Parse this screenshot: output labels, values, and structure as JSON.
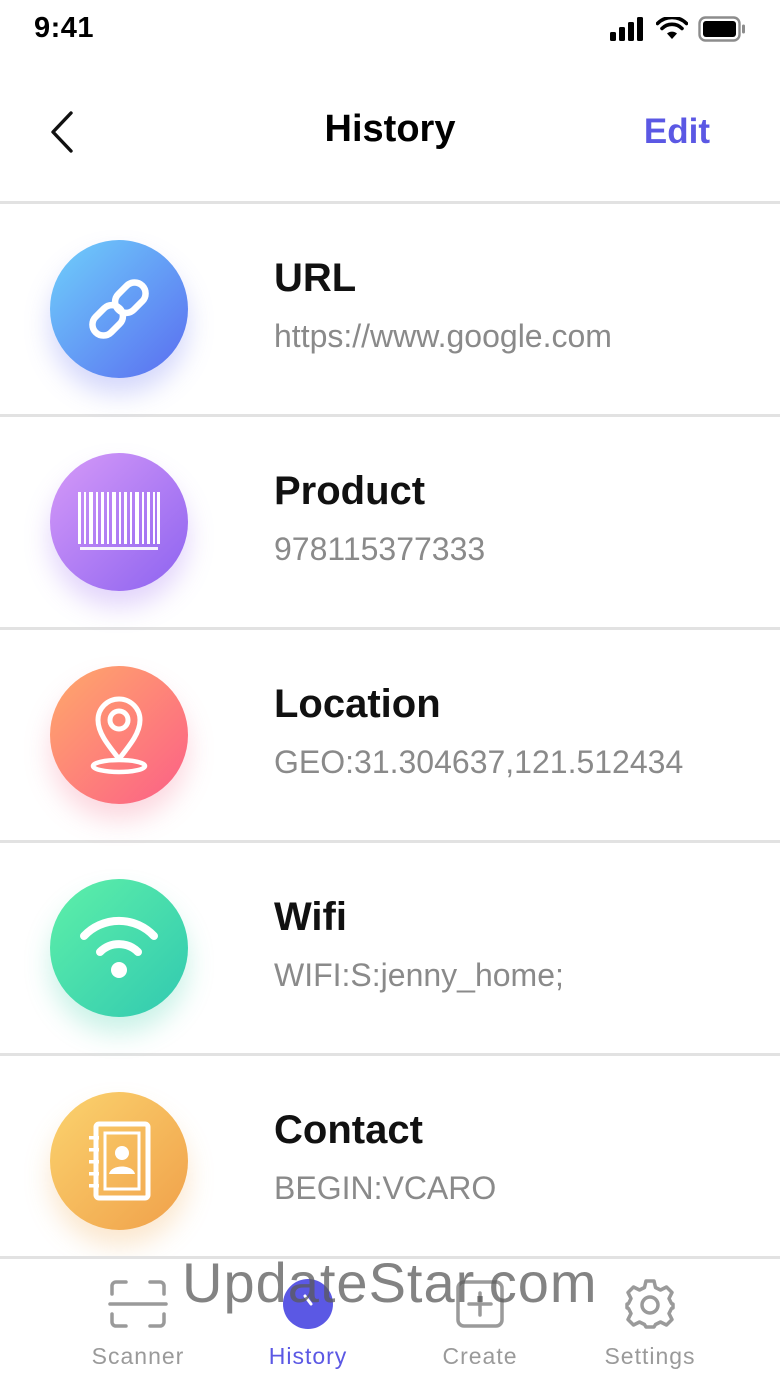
{
  "status_bar": {
    "time": "9:41",
    "icons": [
      "signal-icon",
      "wifi-icon",
      "battery-icon"
    ]
  },
  "nav": {
    "back_icon": "chevron-left-icon",
    "title": "History",
    "edit_label": "Edit",
    "accent_color": "#5b58e4"
  },
  "history": {
    "items": [
      {
        "title": "URL",
        "subtitle": "https://www.google.com",
        "icon": "link-icon",
        "colors": [
          "#6fd0fb",
          "#5a6cf0"
        ]
      },
      {
        "title": "Product",
        "subtitle": "978115377333",
        "icon": "barcode-icon",
        "colors": [
          "#d69af8",
          "#8d63f0"
        ]
      },
      {
        "title": "Location",
        "subtitle": "GEO:31.304637,121.512434",
        "icon": "location-pin-icon",
        "colors": [
          "#ffa96a",
          "#fc5f87"
        ]
      },
      {
        "title": "Wifi",
        "subtitle": "WIFI:S:jenny_home;",
        "icon": "wifi-icon",
        "colors": [
          "#5ef0a8",
          "#31c9b1"
        ]
      },
      {
        "title": "Contact",
        "subtitle": "BEGIN:VCARO",
        "icon": "contact-book-icon",
        "colors": [
          "#fbd36e",
          "#f0a04a"
        ]
      }
    ]
  },
  "tab_bar": {
    "tabs": [
      {
        "label": "Scanner",
        "icon": "scan-frame-icon",
        "active": false
      },
      {
        "label": "History",
        "icon": "clock-icon",
        "active": true
      },
      {
        "label": "Create",
        "icon": "plus-square-icon",
        "active": false
      },
      {
        "label": "Settings",
        "icon": "gear-icon",
        "active": false
      }
    ]
  },
  "watermark": "UpdateStar.com"
}
